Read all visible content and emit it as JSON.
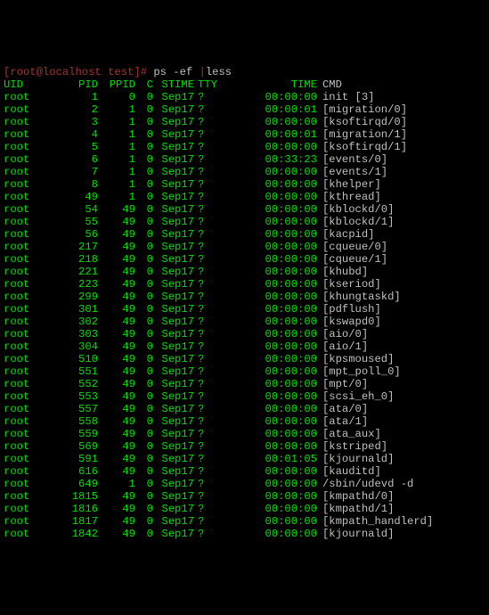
{
  "prompt": {
    "user": "root",
    "at": "@",
    "host": "localhost",
    "dir": "test",
    "open": "[",
    "close": "]#",
    "command": "ps -ef",
    "pipe": "|",
    "pager": "less"
  },
  "headers": {
    "uid": "UID",
    "pid": "PID",
    "ppid": "PPID",
    "c": "C",
    "stime": "STIME",
    "tty": "TTY",
    "time": "TIME",
    "cmd": "CMD"
  },
  "rows": [
    {
      "uid": "root",
      "pid": "1",
      "ppid": "0",
      "c": "0",
      "stime": "Sep17",
      "tty": "?",
      "time": "00:00:00",
      "cmd": "init [3]"
    },
    {
      "uid": "root",
      "pid": "2",
      "ppid": "1",
      "c": "0",
      "stime": "Sep17",
      "tty": "?",
      "time": "00:00:01",
      "cmd": "[migration/0]"
    },
    {
      "uid": "root",
      "pid": "3",
      "ppid": "1",
      "c": "0",
      "stime": "Sep17",
      "tty": "?",
      "time": "00:00:00",
      "cmd": "[ksoftirqd/0]"
    },
    {
      "uid": "root",
      "pid": "4",
      "ppid": "1",
      "c": "0",
      "stime": "Sep17",
      "tty": "?",
      "time": "00:00:01",
      "cmd": "[migration/1]"
    },
    {
      "uid": "root",
      "pid": "5",
      "ppid": "1",
      "c": "0",
      "stime": "Sep17",
      "tty": "?",
      "time": "00:00:00",
      "cmd": "[ksoftirqd/1]"
    },
    {
      "uid": "root",
      "pid": "6",
      "ppid": "1",
      "c": "0",
      "stime": "Sep17",
      "tty": "?",
      "time": "00:33:23",
      "cmd": "[events/0]"
    },
    {
      "uid": "root",
      "pid": "7",
      "ppid": "1",
      "c": "0",
      "stime": "Sep17",
      "tty": "?",
      "time": "00:00:00",
      "cmd": "[events/1]"
    },
    {
      "uid": "root",
      "pid": "8",
      "ppid": "1",
      "c": "0",
      "stime": "Sep17",
      "tty": "?",
      "time": "00:00:00",
      "cmd": "[khelper]"
    },
    {
      "uid": "root",
      "pid": "49",
      "ppid": "1",
      "c": "0",
      "stime": "Sep17",
      "tty": "?",
      "time": "00:00:00",
      "cmd": "[kthread]"
    },
    {
      "uid": "root",
      "pid": "54",
      "ppid": "49",
      "c": "0",
      "stime": "Sep17",
      "tty": "?",
      "time": "00:00:00",
      "cmd": "[kblockd/0]"
    },
    {
      "uid": "root",
      "pid": "55",
      "ppid": "49",
      "c": "0",
      "stime": "Sep17",
      "tty": "?",
      "time": "00:00:00",
      "cmd": "[kblockd/1]"
    },
    {
      "uid": "root",
      "pid": "56",
      "ppid": "49",
      "c": "0",
      "stime": "Sep17",
      "tty": "?",
      "time": "00:00:00",
      "cmd": "[kacpid]"
    },
    {
      "uid": "root",
      "pid": "217",
      "ppid": "49",
      "c": "0",
      "stime": "Sep17",
      "tty": "?",
      "time": "00:00:00",
      "cmd": "[cqueue/0]"
    },
    {
      "uid": "root",
      "pid": "218",
      "ppid": "49",
      "c": "0",
      "stime": "Sep17",
      "tty": "?",
      "time": "00:00:00",
      "cmd": "[cqueue/1]"
    },
    {
      "uid": "root",
      "pid": "221",
      "ppid": "49",
      "c": "0",
      "stime": "Sep17",
      "tty": "?",
      "time": "00:00:00",
      "cmd": "[khubd]"
    },
    {
      "uid": "root",
      "pid": "223",
      "ppid": "49",
      "c": "0",
      "stime": "Sep17",
      "tty": "?",
      "time": "00:00:00",
      "cmd": "[kseriod]"
    },
    {
      "uid": "root",
      "pid": "299",
      "ppid": "49",
      "c": "0",
      "stime": "Sep17",
      "tty": "?",
      "time": "00:00:00",
      "cmd": "[khungtaskd]"
    },
    {
      "uid": "root",
      "pid": "301",
      "ppid": "49",
      "c": "0",
      "stime": "Sep17",
      "tty": "?",
      "time": "00:00:00",
      "cmd": "[pdflush]"
    },
    {
      "uid": "root",
      "pid": "302",
      "ppid": "49",
      "c": "0",
      "stime": "Sep17",
      "tty": "?",
      "time": "00:00:00",
      "cmd": "[kswapd0]"
    },
    {
      "uid": "root",
      "pid": "303",
      "ppid": "49",
      "c": "0",
      "stime": "Sep17",
      "tty": "?",
      "time": "00:00:00",
      "cmd": "[aio/0]"
    },
    {
      "uid": "root",
      "pid": "304",
      "ppid": "49",
      "c": "0",
      "stime": "Sep17",
      "tty": "?",
      "time": "00:00:00",
      "cmd": "[aio/1]"
    },
    {
      "uid": "root",
      "pid": "510",
      "ppid": "49",
      "c": "0",
      "stime": "Sep17",
      "tty": "?",
      "time": "00:00:00",
      "cmd": "[kpsmoused]"
    },
    {
      "uid": "root",
      "pid": "551",
      "ppid": "49",
      "c": "0",
      "stime": "Sep17",
      "tty": "?",
      "time": "00:00:00",
      "cmd": "[mpt_poll_0]"
    },
    {
      "uid": "root",
      "pid": "552",
      "ppid": "49",
      "c": "0",
      "stime": "Sep17",
      "tty": "?",
      "time": "00:00:00",
      "cmd": "[mpt/0]"
    },
    {
      "uid": "root",
      "pid": "553",
      "ppid": "49",
      "c": "0",
      "stime": "Sep17",
      "tty": "?",
      "time": "00:00:00",
      "cmd": "[scsi_eh_0]"
    },
    {
      "uid": "root",
      "pid": "557",
      "ppid": "49",
      "c": "0",
      "stime": "Sep17",
      "tty": "?",
      "time": "00:00:00",
      "cmd": "[ata/0]"
    },
    {
      "uid": "root",
      "pid": "558",
      "ppid": "49",
      "c": "0",
      "stime": "Sep17",
      "tty": "?",
      "time": "00:00:00",
      "cmd": "[ata/1]"
    },
    {
      "uid": "root",
      "pid": "559",
      "ppid": "49",
      "c": "0",
      "stime": "Sep17",
      "tty": "?",
      "time": "00:00:00",
      "cmd": "[ata_aux]"
    },
    {
      "uid": "root",
      "pid": "569",
      "ppid": "49",
      "c": "0",
      "stime": "Sep17",
      "tty": "?",
      "time": "00:00:00",
      "cmd": "[kstriped]"
    },
    {
      "uid": "root",
      "pid": "591",
      "ppid": "49",
      "c": "0",
      "stime": "Sep17",
      "tty": "?",
      "time": "00:01:05",
      "cmd": "[kjournald]"
    },
    {
      "uid": "root",
      "pid": "616",
      "ppid": "49",
      "c": "0",
      "stime": "Sep17",
      "tty": "?",
      "time": "00:00:00",
      "cmd": "[kauditd]"
    },
    {
      "uid": "root",
      "pid": "649",
      "ppid": "1",
      "c": "0",
      "stime": "Sep17",
      "tty": "?",
      "time": "00:00:00",
      "cmd": "/sbin/udevd -d"
    },
    {
      "uid": "root",
      "pid": "1815",
      "ppid": "49",
      "c": "0",
      "stime": "Sep17",
      "tty": "?",
      "time": "00:00:00",
      "cmd": "[kmpathd/0]"
    },
    {
      "uid": "root",
      "pid": "1816",
      "ppid": "49",
      "c": "0",
      "stime": "Sep17",
      "tty": "?",
      "time": "00:00:00",
      "cmd": "[kmpathd/1]"
    },
    {
      "uid": "root",
      "pid": "1817",
      "ppid": "49",
      "c": "0",
      "stime": "Sep17",
      "tty": "?",
      "time": "00:00:00",
      "cmd": "[kmpath_handlerd]"
    },
    {
      "uid": "root",
      "pid": "1842",
      "ppid": "49",
      "c": "0",
      "stime": "Sep17",
      "tty": "?",
      "time": "00:00:00",
      "cmd": "[kjournald]"
    }
  ]
}
